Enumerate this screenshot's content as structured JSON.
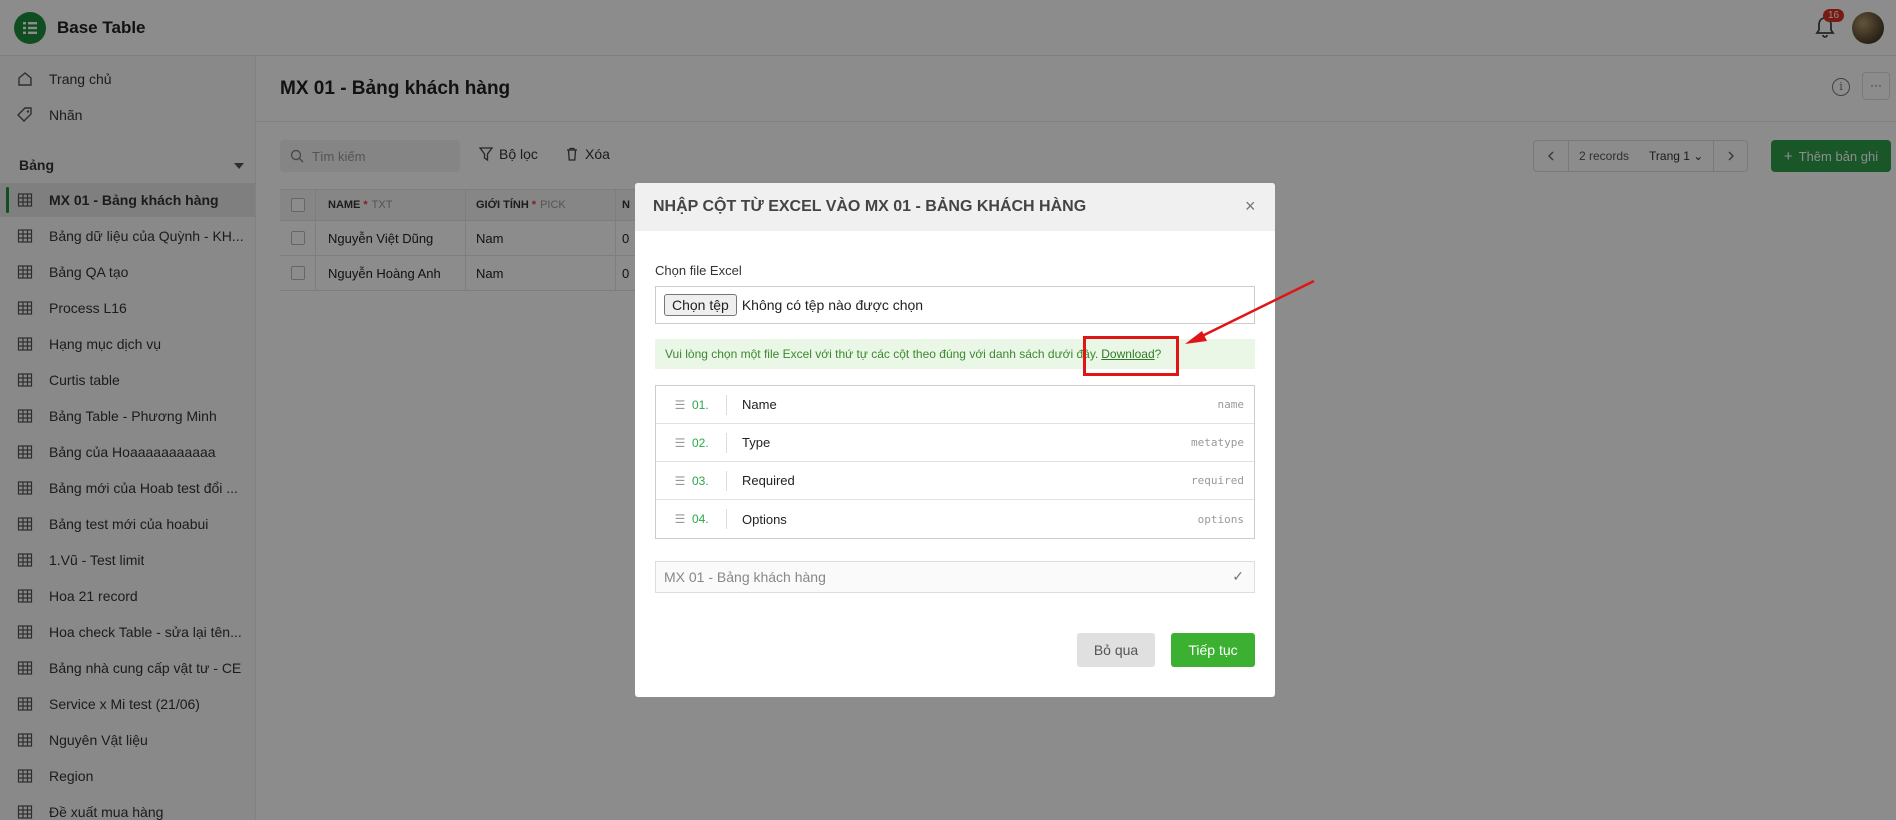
{
  "app": {
    "title": "Base Table",
    "notification_count": "16"
  },
  "sidebar": {
    "nav": [
      {
        "label": "Trang chủ",
        "icon": "home-icon"
      },
      {
        "label": "Nhãn",
        "icon": "tag-icon"
      }
    ],
    "section_title": "Bảng",
    "tables": [
      "MX 01 - Bảng khách hàng",
      "Bảng dữ liệu của Quỳnh - KH...",
      "Bảng QA tạo",
      "Process L16",
      "Hạng mục dịch vụ",
      "Curtis table",
      "Bảng Table - Phương Minh",
      "Bảng của Hoaaaaaaaaaaa",
      "Bảng mới của Hoab test đổi ...",
      "Bảng test mới của hoabui",
      "1.Vũ - Test limit",
      "Hoa 21 record",
      "Hoa check Table - sửa lại tên...",
      "Bảng nhà cung cấp vật tư - CE",
      "Service x Mi test (21/06)",
      "Nguyên Vật liệu",
      "Region",
      "Đề xuất mua hàng"
    ],
    "active_index": 0
  },
  "main": {
    "title": "MX 01 - Bảng khách hàng",
    "more_label": "···",
    "search_placeholder": "Tìm kiếm",
    "filter_label": "Bộ lọc",
    "delete_label": "Xóa",
    "pager": {
      "records": "2 records",
      "page": "Trang 1"
    },
    "add_label": "Thêm bản ghi",
    "grid": {
      "headers": {
        "name": "NAME",
        "name_req": "*",
        "name_type": "TXT",
        "sex": "GIỚI TÍNH",
        "sex_req": "*",
        "sex_type": "PICK",
        "more": "N"
      },
      "rows": [
        {
          "name": "Nguyễn Việt Dũng",
          "sex": "Nam",
          "more": "0"
        },
        {
          "name": "Nguyễn Hoàng Anh",
          "sex": "Nam",
          "more": "0"
        }
      ]
    }
  },
  "modal": {
    "title": "NHẬP CỘT TỪ EXCEL VÀO MX 01 - BẢNG KHÁCH HÀNG",
    "close": "×",
    "file_label": "Chọn file Excel",
    "file_button": "Chọn tệp",
    "file_status": "Không có tệp nào được chọn",
    "hint_text": "Vui lòng chọn một file Excel với thứ tự các cột theo đúng với danh sách dưới đây.",
    "hint_link": "Download",
    "hint_suffix": "?",
    "columns": [
      {
        "num": "01.",
        "name": "Name",
        "key": "name"
      },
      {
        "num": "02.",
        "name": "Type",
        "key": "metatype"
      },
      {
        "num": "03.",
        "name": "Required",
        "key": "required"
      },
      {
        "num": "04.",
        "name": "Options",
        "key": "options"
      }
    ],
    "target_table": "MX 01 - Bảng khách hàng",
    "target_check": "✓",
    "skip_label": "Bỏ qua",
    "next_label": "Tiếp tục"
  },
  "colors": {
    "brand": "#1e8e3e",
    "primary_button": "#3cb031",
    "annotation": "#e01515"
  }
}
